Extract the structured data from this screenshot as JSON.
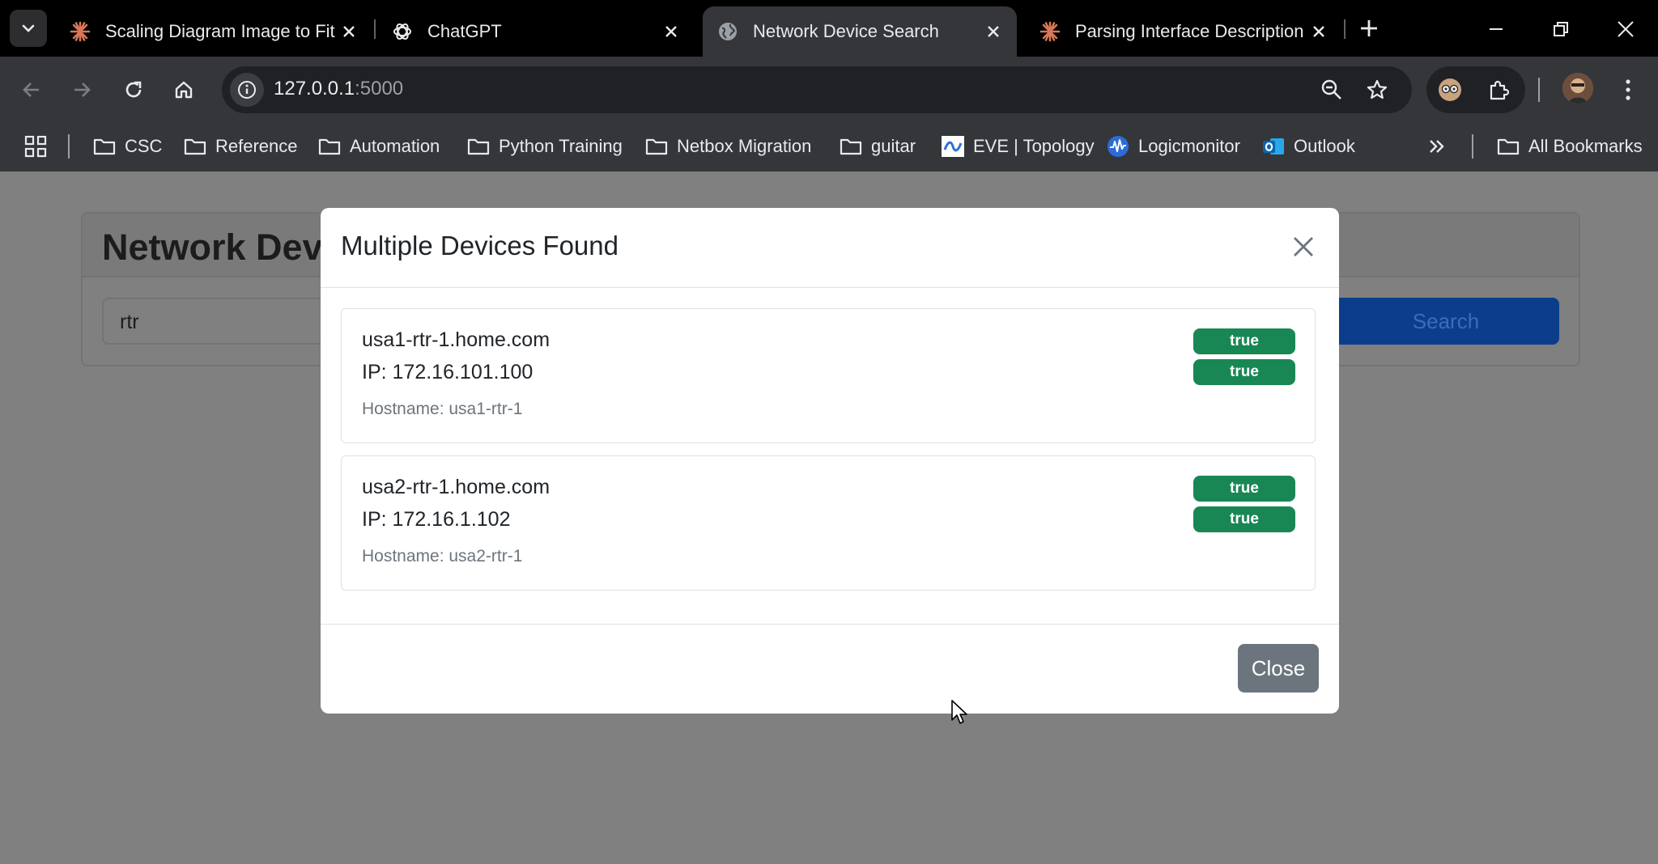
{
  "browser": {
    "tabs": [
      {
        "title": "Scaling Diagram Image to Fit",
        "favicon": "claude-icon",
        "active": false
      },
      {
        "title": "ChatGPT",
        "favicon": "chatgpt-icon",
        "active": false
      },
      {
        "title": "Network Device Search",
        "favicon": "globe-icon",
        "active": true
      },
      {
        "title": "Parsing Interface Description (",
        "favicon": "claude-icon",
        "active": false
      }
    ],
    "address": {
      "host": "127.0.0.1",
      "port": ":5000"
    },
    "bookmarks": [
      {
        "label": "CSC",
        "icon": "folder-icon"
      },
      {
        "label": "Reference",
        "icon": "folder-icon"
      },
      {
        "label": "Automation",
        "icon": "folder-icon"
      },
      {
        "label": "Python Training",
        "icon": "folder-icon"
      },
      {
        "label": "Netbox Migration",
        "icon": "folder-icon"
      },
      {
        "label": "guitar",
        "icon": "folder-icon"
      },
      {
        "label": "EVE | Topology",
        "icon": "eve-icon"
      },
      {
        "label": "Logicmonitor",
        "icon": "logicmonitor-icon"
      },
      {
        "label": "Outlook",
        "icon": "outlook-icon"
      }
    ],
    "all_bookmarks": "All Bookmarks"
  },
  "page": {
    "title": "Network Devi",
    "search_value": "rtr",
    "search_button": "Search"
  },
  "modal": {
    "title": "Multiple Devices Found",
    "devices": [
      {
        "name": "usa1-rtr-1.home.com",
        "ip": "IP: 172.16.101.100",
        "hostname": "Hostname: usa1-rtr-1",
        "badges": [
          "true",
          "true"
        ]
      },
      {
        "name": "usa2-rtr-1.home.com",
        "ip": "IP: 172.16.1.102",
        "hostname": "Hostname: usa2-rtr-1",
        "badges": [
          "true",
          "true"
        ]
      }
    ],
    "close_button": "Close"
  },
  "colors": {
    "badge_success": "#198754",
    "close_secondary": "#6c757d",
    "search_primary": "#0d6efd"
  }
}
